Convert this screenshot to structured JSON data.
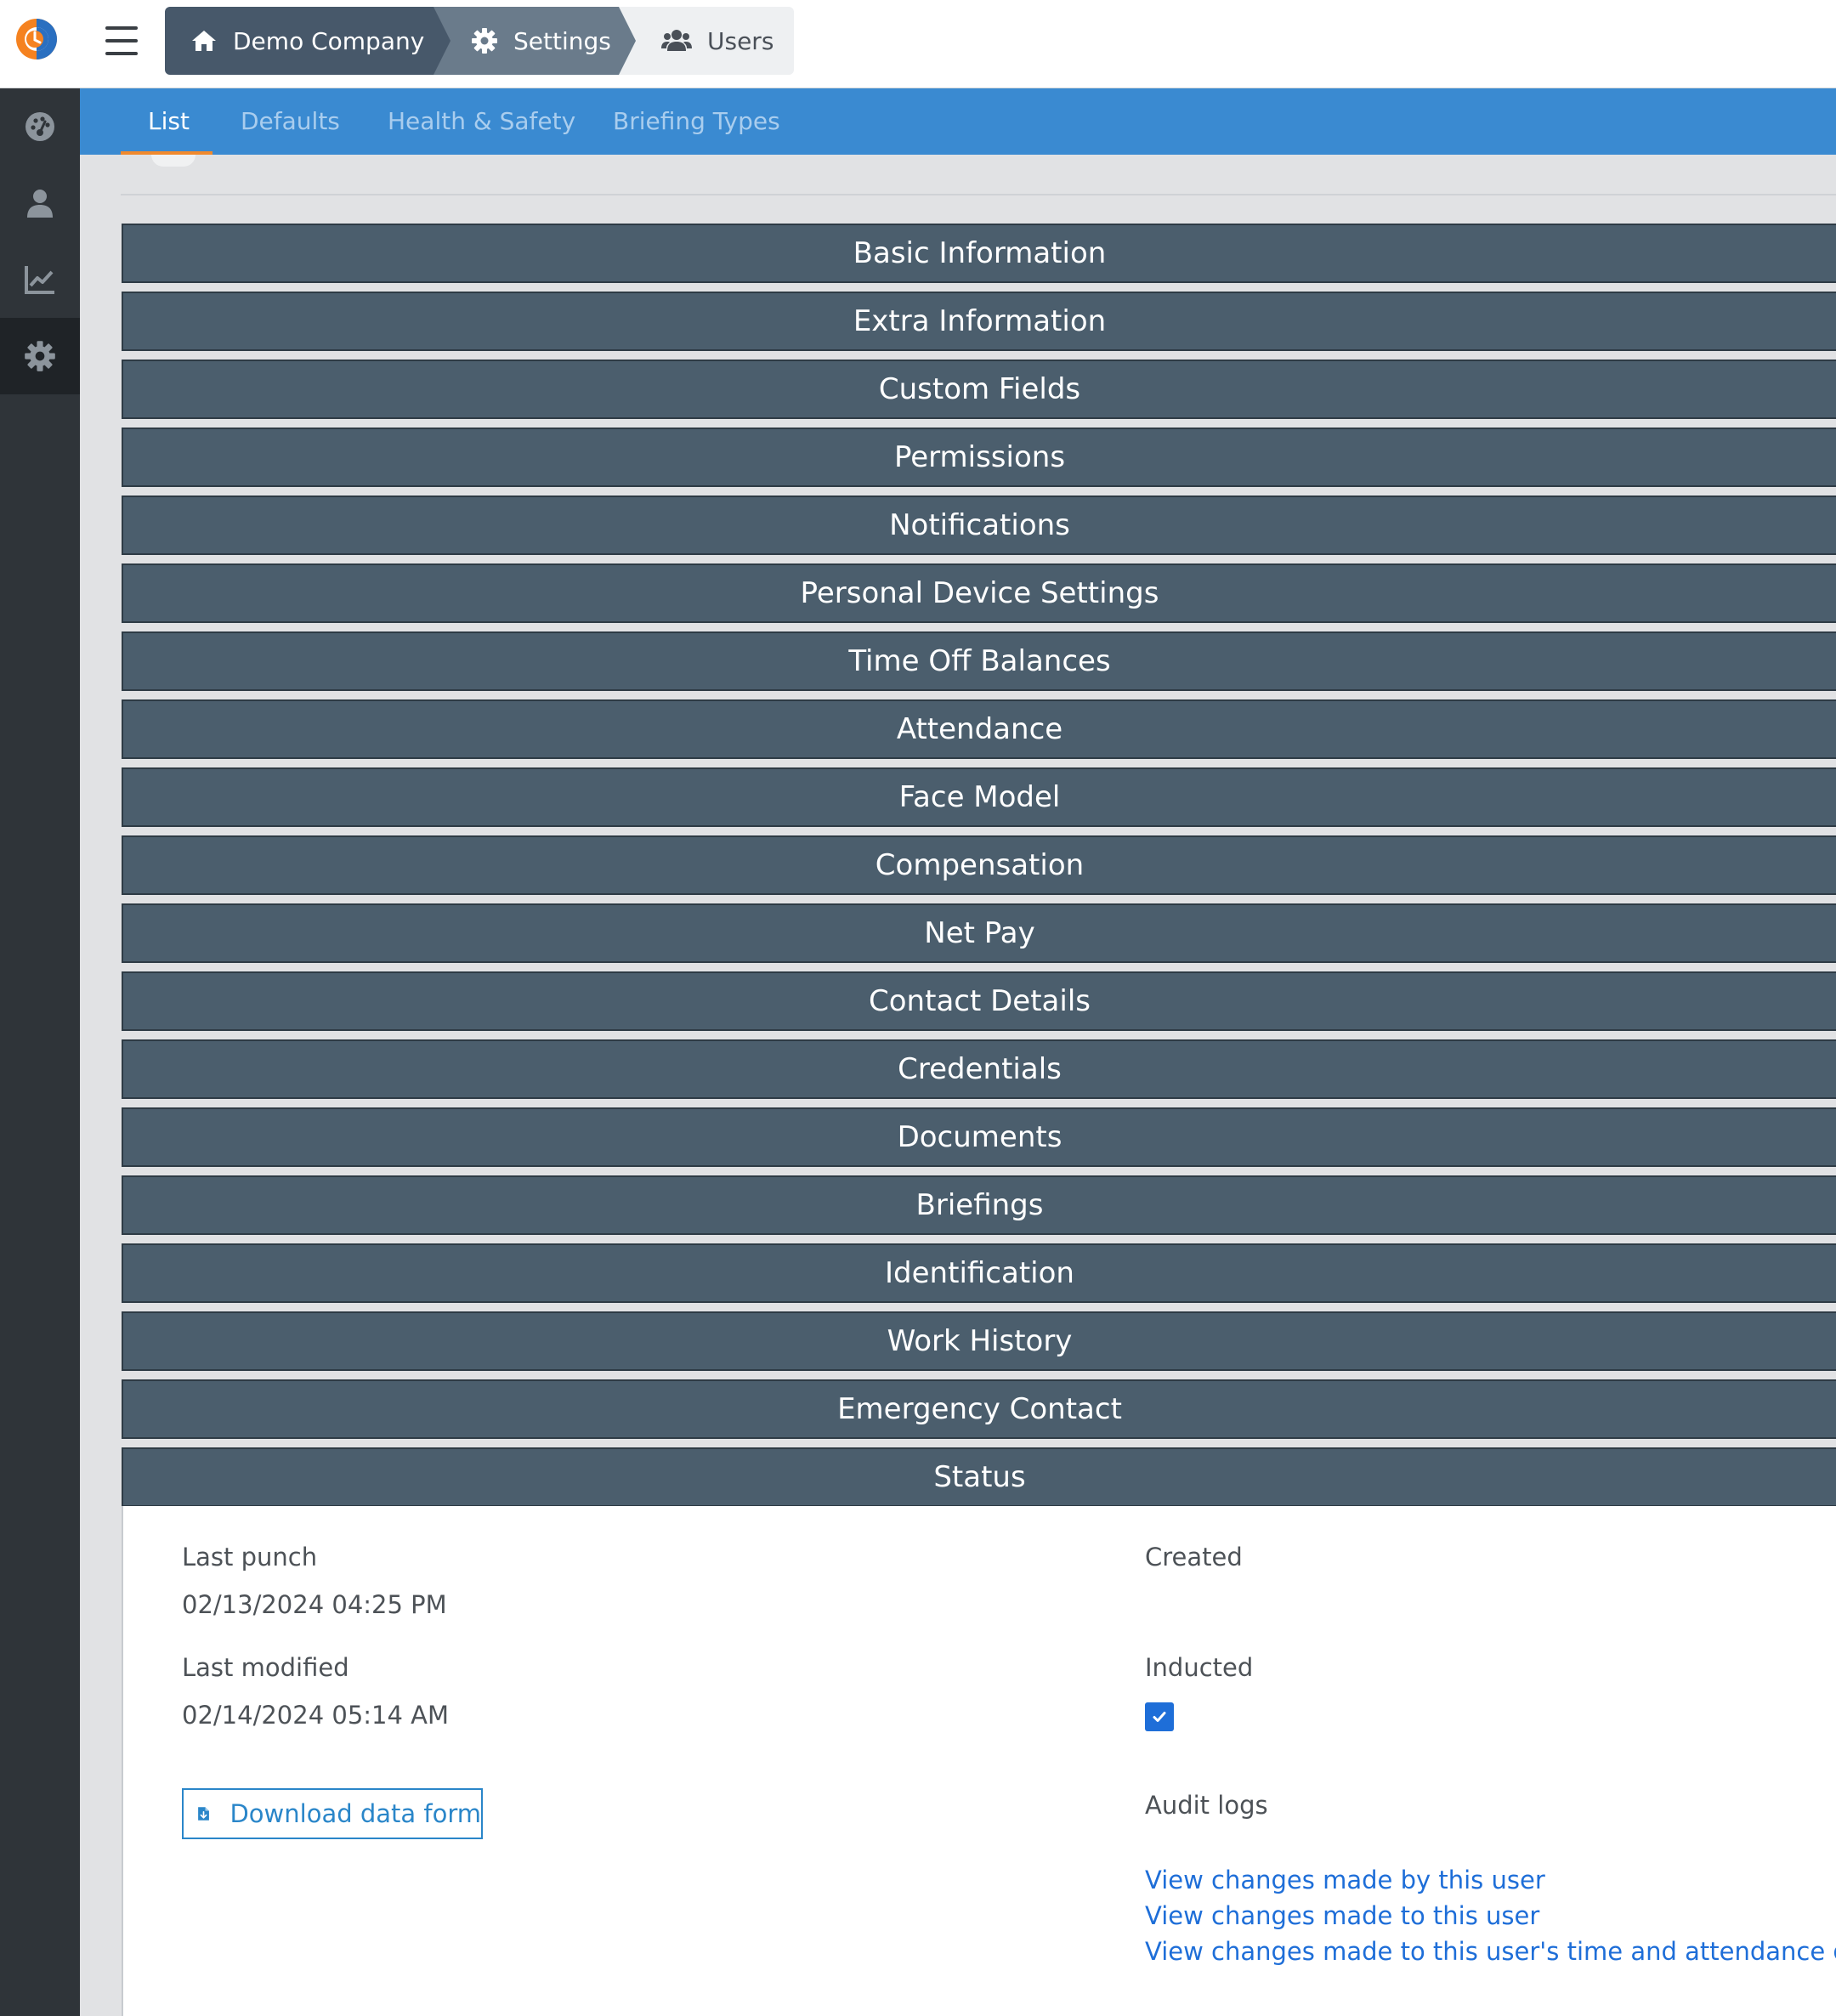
{
  "breadcrumbs": [
    {
      "label": "Demo Company",
      "icon": "home-icon"
    },
    {
      "label": "Settings",
      "icon": "gear-icon"
    },
    {
      "label": "Users",
      "icon": "users-icon"
    }
  ],
  "sidebar": {
    "items": [
      {
        "icon": "dashboard-icon",
        "active": false
      },
      {
        "icon": "user-icon",
        "active": false
      },
      {
        "icon": "chart-line-icon",
        "active": false
      },
      {
        "icon": "gear-icon",
        "active": true
      }
    ]
  },
  "tabs": [
    {
      "label": "List",
      "active": true
    },
    {
      "label": "Defaults",
      "active": false
    },
    {
      "label": "Health & Safety",
      "active": false
    },
    {
      "label": "Briefing Types",
      "active": false
    }
  ],
  "sections": [
    "Basic Information",
    "Extra Information",
    "Custom Fields",
    "Permissions",
    "Notifications",
    "Personal Device Settings",
    "Time Off Balances",
    "Attendance",
    "Face Model",
    "Compensation",
    "Net Pay",
    "Contact Details",
    "Credentials",
    "Documents",
    "Briefings",
    "Identification",
    "Work History",
    "Emergency Contact",
    "Status"
  ],
  "status": {
    "last_punch_label": "Last punch",
    "last_punch_value": "02/13/2024 04:25 PM",
    "last_modified_label": "Last modified",
    "last_modified_value": "02/14/2024 05:14 AM",
    "created_label": "Created",
    "inducted_label": "Inducted",
    "inducted_checked": true,
    "download_label": "Download data form",
    "audit_logs_label": "Audit logs",
    "audit_links": [
      "View changes made by this user",
      "View changes made to this user",
      "View changes made to this user's time and attendance data"
    ]
  },
  "colors": {
    "topbar_bg": "#ffffff",
    "sidebar_bg": "#2f3439",
    "tabbar_bg": "#3a8ad1",
    "tab_underline": "#f0892d",
    "section_bg": "#4b5e6d",
    "link": "#1e6ed8",
    "checkbox": "#1e6ed8"
  }
}
